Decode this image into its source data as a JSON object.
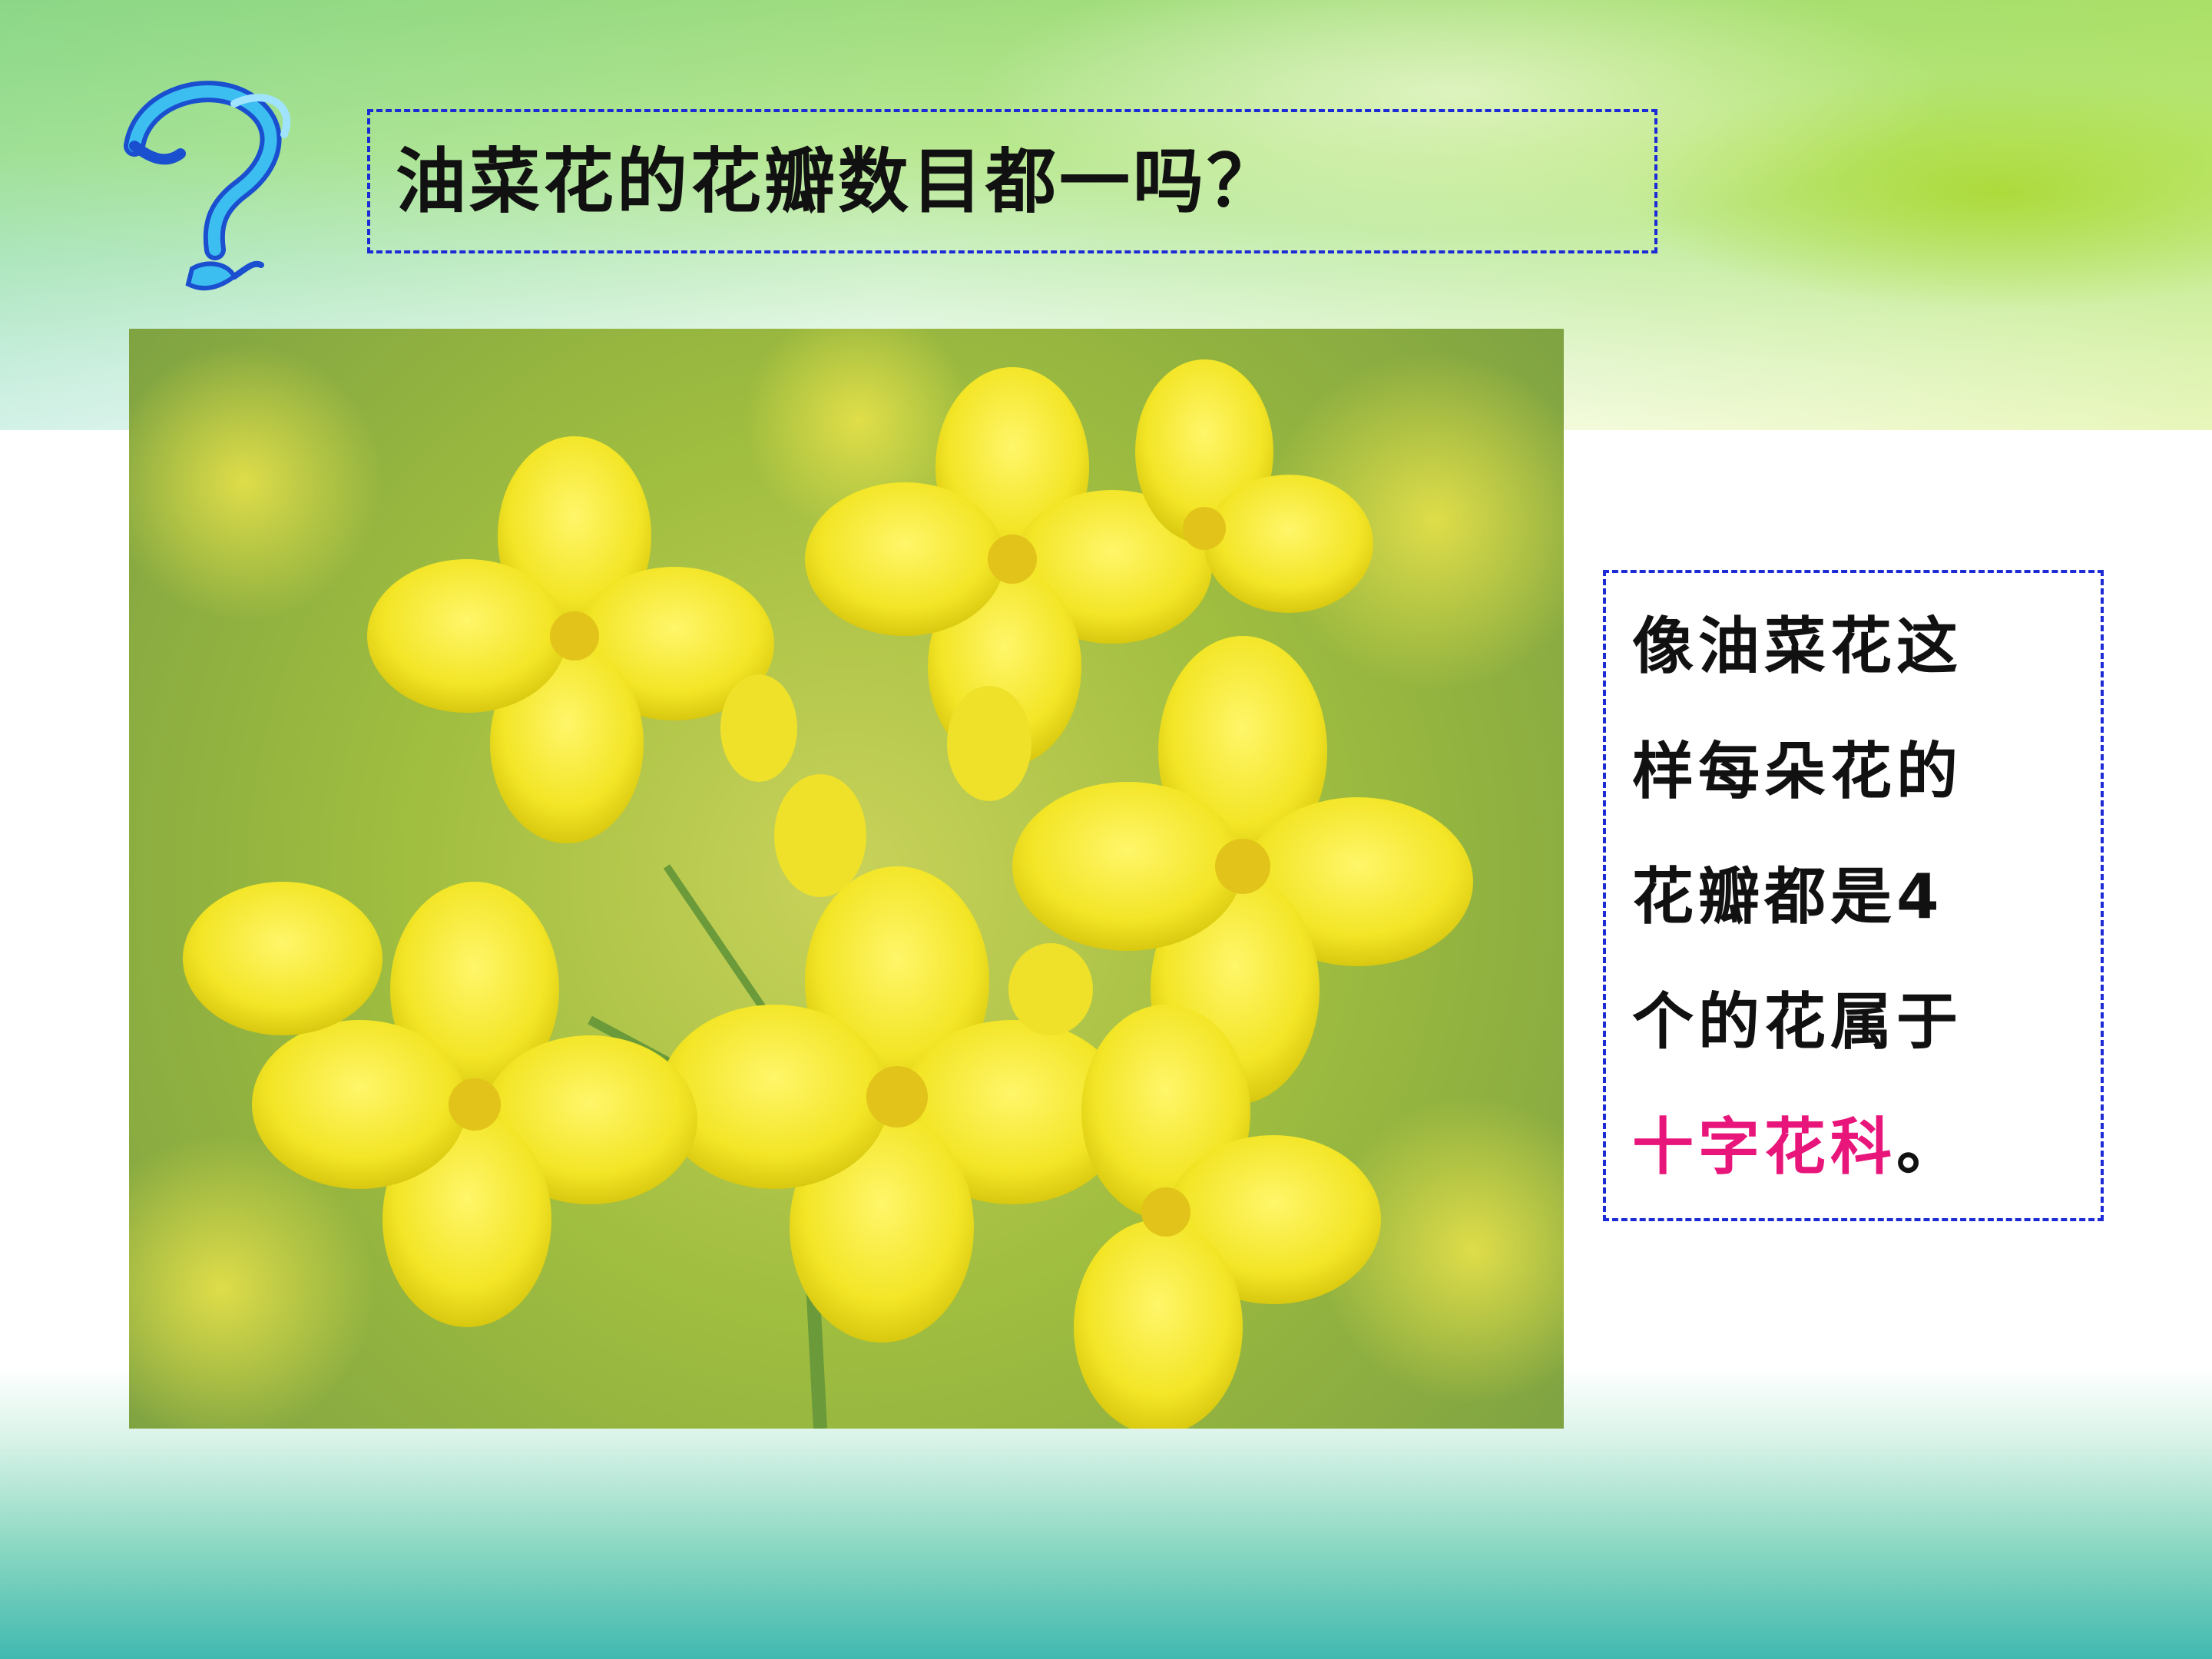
{
  "slide": {
    "title": "油菜花的花瓣数目都一吗？",
    "image_alt": "油菜花",
    "info_lines": [
      "像油菜花这",
      "样每朵花的",
      "花瓣都是4",
      "个的花属于"
    ],
    "highlight_text": "十字花科",
    "end_punct": "。"
  },
  "icons": {
    "question": "question-mark-icon"
  },
  "colors": {
    "title_border": "#1d2bd6",
    "info_border": "#1d2bd6",
    "highlight": "#e8157a",
    "icon_blue": "#2fa7ea"
  }
}
